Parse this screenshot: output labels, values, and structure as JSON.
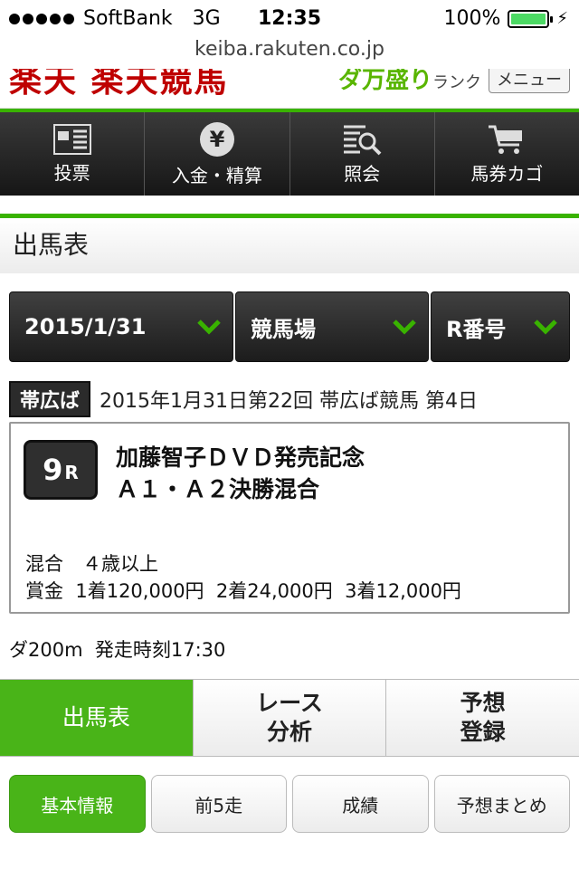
{
  "status_bar": {
    "carrier": "SoftBank",
    "network": "3G",
    "time": "12:35",
    "battery": "100%"
  },
  "browser": {
    "url": "keiba.rakuten.co.jp"
  },
  "header": {
    "logo_text": "楽天 楽天競馬",
    "promo_text": "ダ万盛り",
    "promo_sub": "ランク",
    "menu_label": "メニュー"
  },
  "nav": {
    "items": [
      {
        "label": "投票",
        "icon": "form-icon"
      },
      {
        "label": "入金・精算",
        "icon": "yen-icon"
      },
      {
        "label": "照会",
        "icon": "search-doc-icon"
      },
      {
        "label": "馬券カゴ",
        "icon": "cart-icon"
      }
    ]
  },
  "page_title": "出馬表",
  "selectors": {
    "date": "2015/1/31",
    "venue": "競馬場",
    "race": "R番号"
  },
  "meeting": {
    "venue_badge": "帯広ば",
    "description": "2015年1月31日第22回 帯広ば競馬 第4日"
  },
  "race": {
    "number": "9",
    "number_suffix": "R",
    "name": "加藤智子ＤＶＤ発売記念 Ａ１・Ａ２決勝混合",
    "condition": "混合　４歳以上",
    "prize": "賞金  1着120,000円  2着24,000円  3着12,000円",
    "distance_start": "ダ200m  発走時刻17:30"
  },
  "big_tabs": [
    {
      "label": "出馬表",
      "active": true
    },
    {
      "label": "レース\n分析",
      "active": false
    },
    {
      "label": "予想\n登録",
      "active": false
    }
  ],
  "sub_tabs": [
    {
      "label": "基本情報",
      "active": true
    },
    {
      "label": "前5走",
      "active": false
    },
    {
      "label": "成績",
      "active": false
    },
    {
      "label": "予想まとめ",
      "active": false
    }
  ],
  "colors": {
    "accent_green": "#49b418",
    "check_green": "#39b300",
    "dark_nav": "#1e1e1e",
    "brand_red": "#bf0000"
  }
}
